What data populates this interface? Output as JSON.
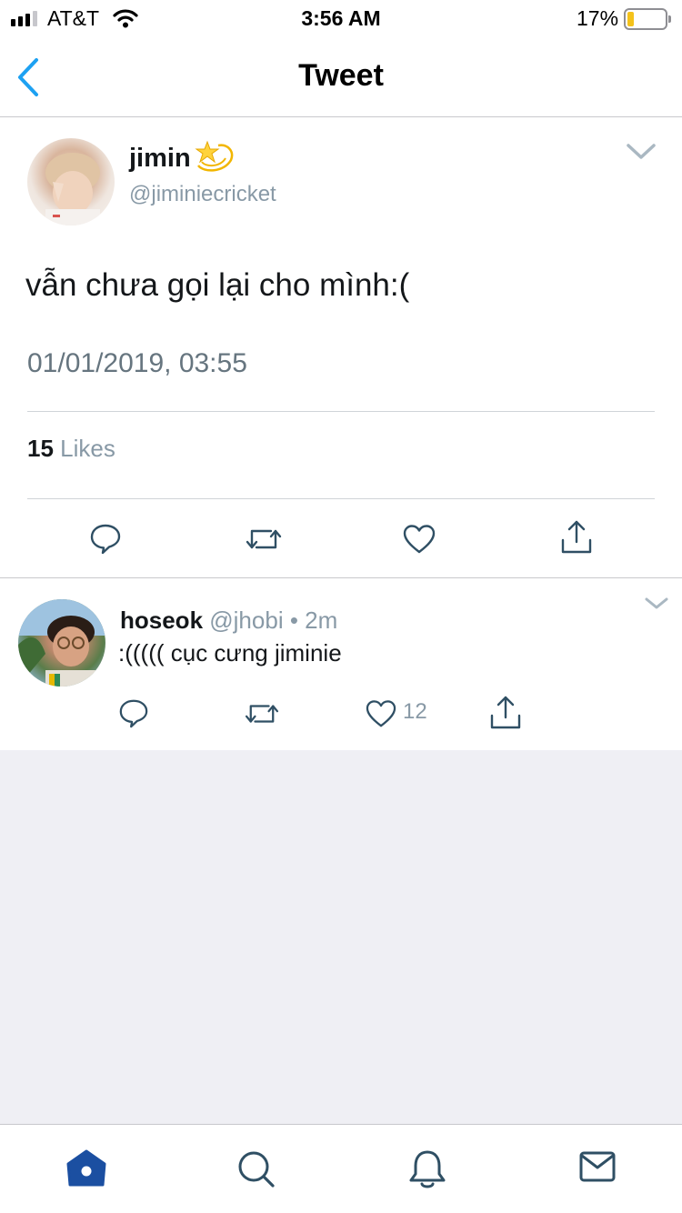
{
  "status_bar": {
    "carrier": "AT&T",
    "time": "3:56 AM",
    "battery_percent": "17%",
    "battery_level": 0.17,
    "battery_color": "#f4c21b"
  },
  "nav": {
    "title": "Tweet",
    "back_icon": "chevron-left-icon"
  },
  "tweet": {
    "author_name": "jimin",
    "author_emoji": "dizzy-star-emoji",
    "author_handle": "@jiminiecricket",
    "text": "vẫn chưa gọi lại cho mình:(",
    "timestamp": "01/01/2019, 03:55",
    "likes_count": "15",
    "likes_label": "Likes",
    "actions": [
      "reply-icon",
      "retweet-icon",
      "heart-icon",
      "share-icon"
    ]
  },
  "reply": {
    "author_name": "hoseok",
    "author_handle": "@jhobi",
    "separator": "•",
    "age": "2m",
    "text": ":((((( cục cưng jiminie",
    "like_count": "12",
    "actions": [
      "reply-icon",
      "retweet-icon",
      "heart-icon",
      "share-icon"
    ]
  },
  "tab_bar": {
    "tabs": [
      "home-icon",
      "search-icon",
      "notifications-icon",
      "messages-icon"
    ],
    "active": "home-icon",
    "accent": "#1b4fa1"
  },
  "colors": {
    "accent_blue": "#1da1f2",
    "secondary_text": "#8899a6",
    "background_empty": "#efeff4"
  }
}
